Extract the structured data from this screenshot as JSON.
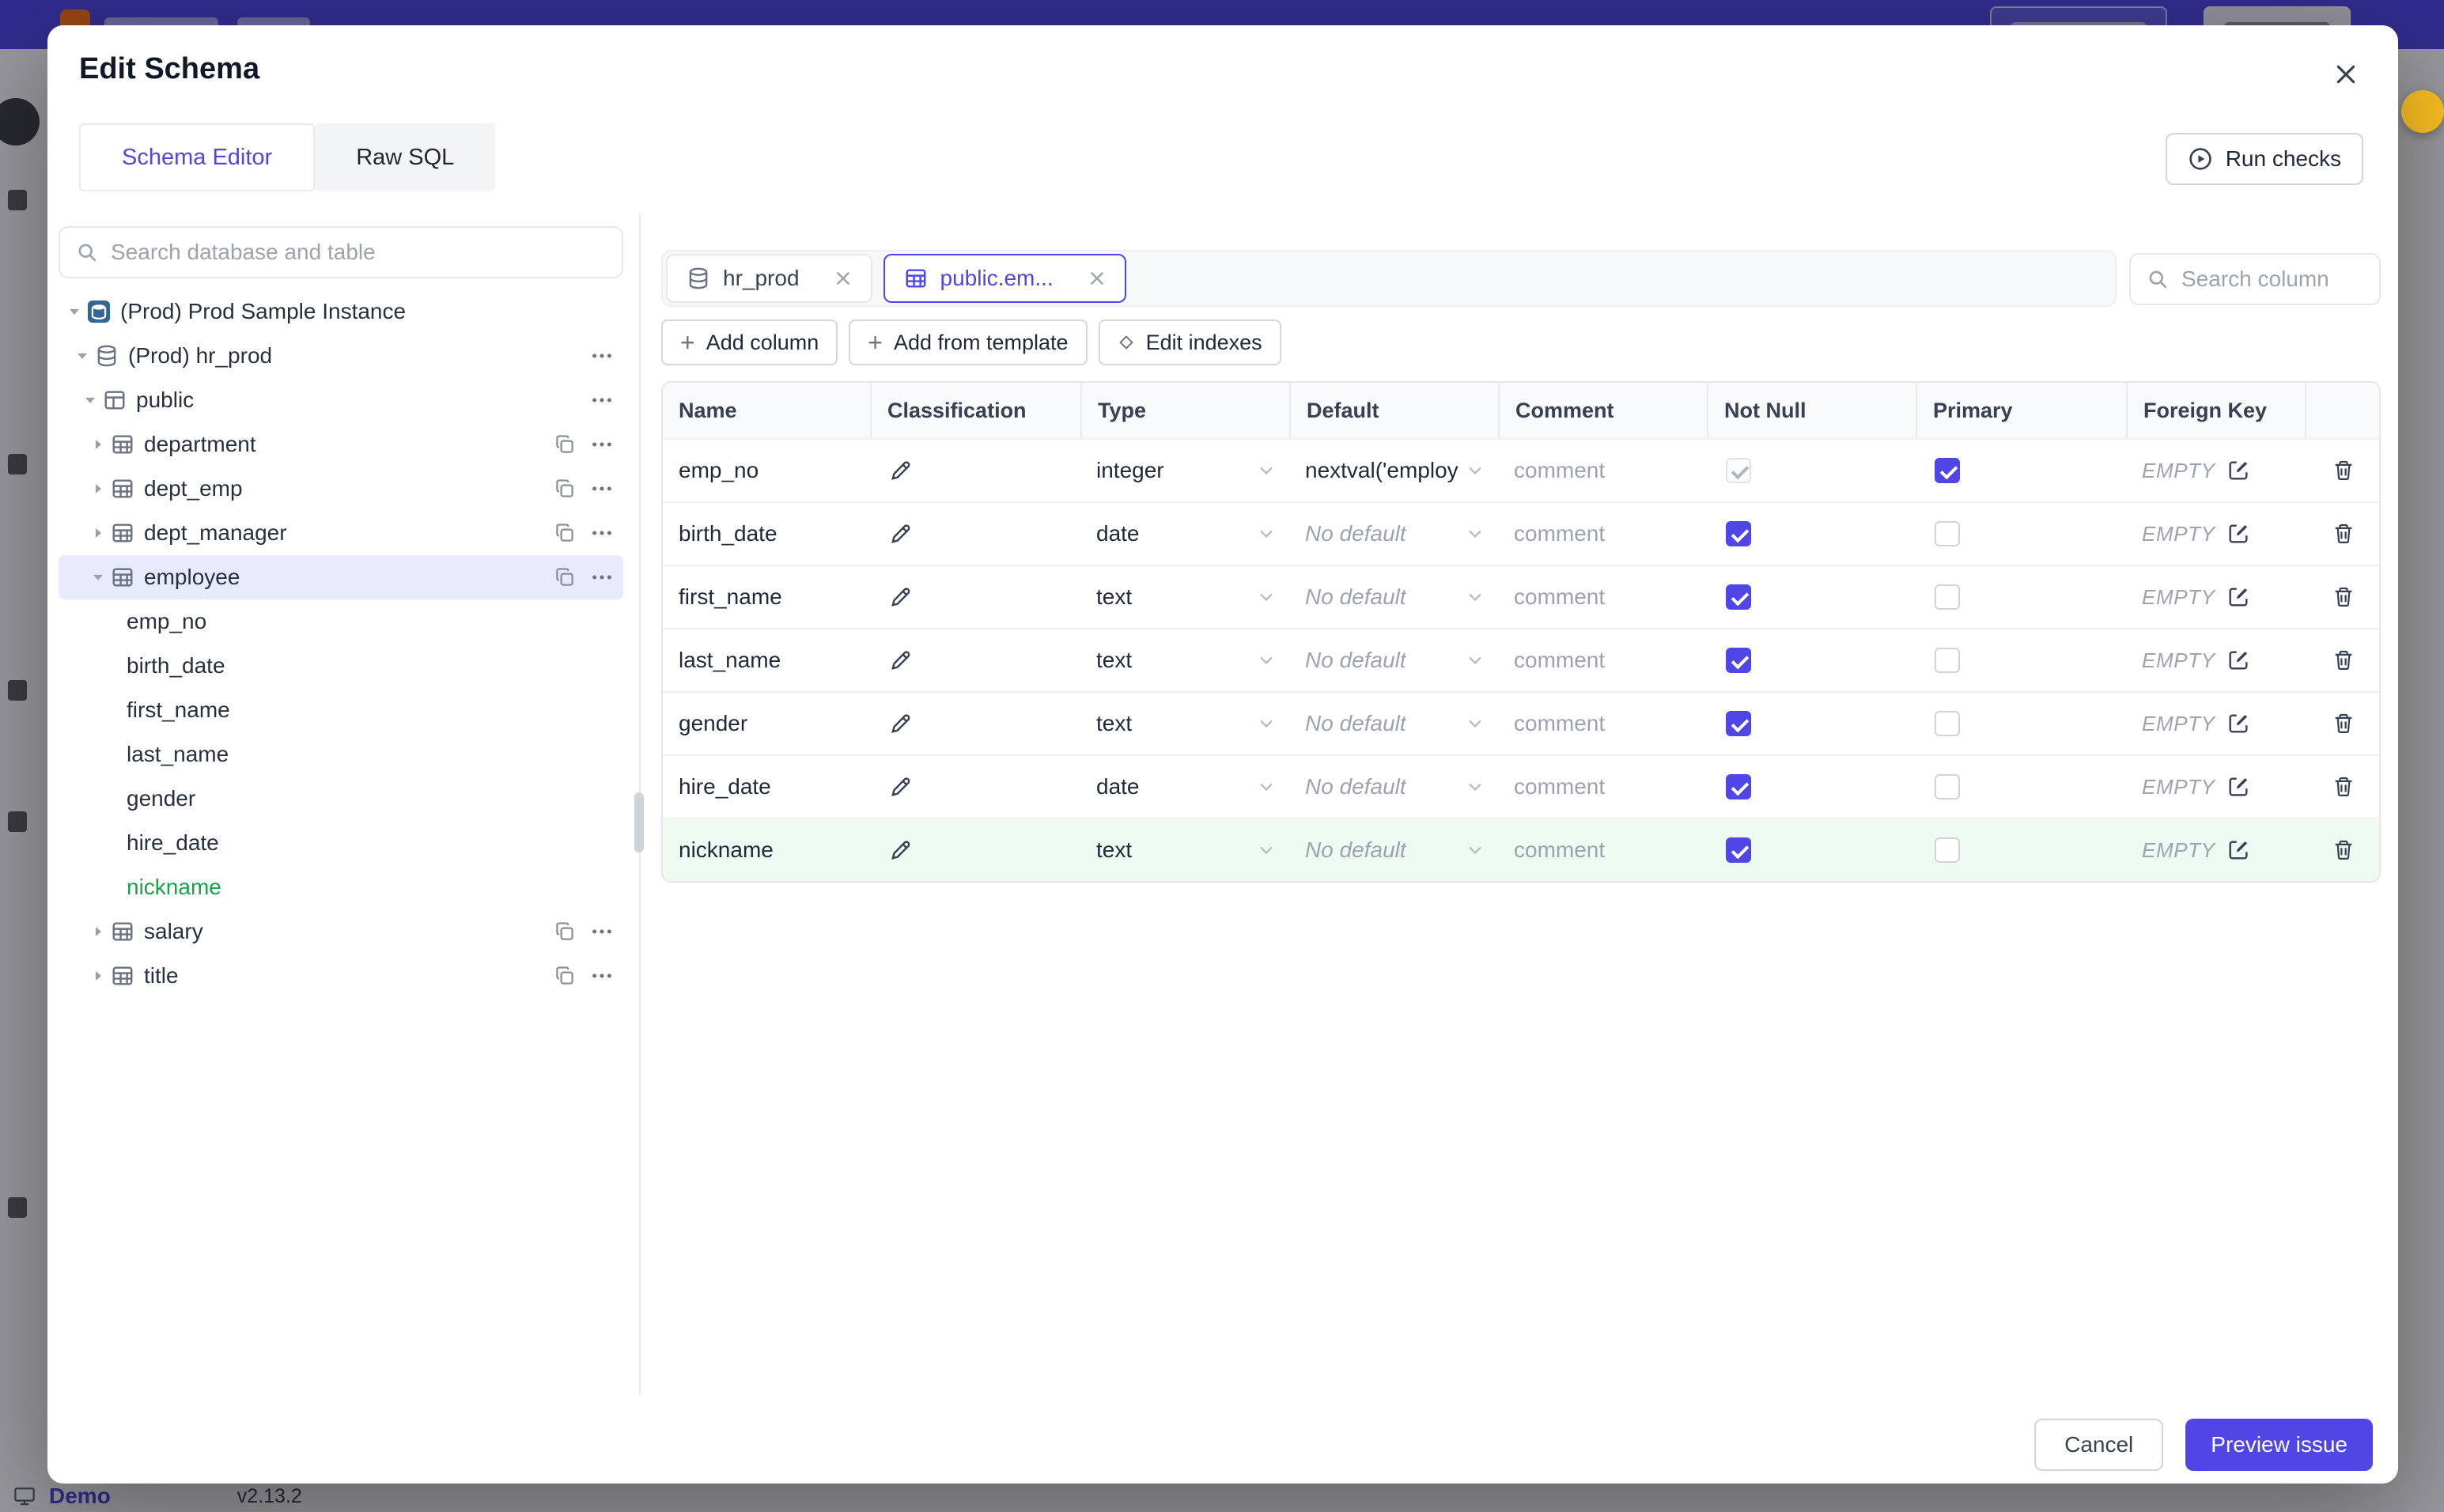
{
  "background": {
    "demo_label": "Demo",
    "version": "v2.13.2"
  },
  "modal": {
    "title": "Edit Schema",
    "tabs": [
      {
        "label": "Schema Editor",
        "active": true
      },
      {
        "label": "Raw SQL",
        "active": false
      }
    ],
    "run_checks": "Run checks",
    "left_panel": {
      "search_placeholder": "Search database and table",
      "tree": [
        {
          "label": "(Prod) Prod Sample Instance",
          "level": 1,
          "icon": "instance",
          "caret": "down"
        },
        {
          "label": "(Prod) hr_prod",
          "level": 2,
          "icon": "database",
          "caret": "down",
          "kebab": true
        },
        {
          "label": "public",
          "level": 3,
          "icon": "schema",
          "caret": "down",
          "kebab": true
        },
        {
          "label": "department",
          "level": 4,
          "icon": "table",
          "caret": "right",
          "copy": true,
          "kebab": true
        },
        {
          "label": "dept_emp",
          "level": 4,
          "icon": "table",
          "caret": "right",
          "copy": true,
          "kebab": true
        },
        {
          "label": "dept_manager",
          "level": 4,
          "icon": "table",
          "caret": "right",
          "copy": true,
          "kebab": true
        },
        {
          "label": "employee",
          "level": 4,
          "icon": "table",
          "caret": "down",
          "copy": true,
          "kebab": true,
          "selected": true
        },
        {
          "label": "emp_no",
          "level": 5
        },
        {
          "label": "birth_date",
          "level": 5
        },
        {
          "label": "first_name",
          "level": 5
        },
        {
          "label": "last_name",
          "level": 5
        },
        {
          "label": "gender",
          "level": 5
        },
        {
          "label": "hire_date",
          "level": 5
        },
        {
          "label": "nickname",
          "level": 5,
          "is_new": true
        },
        {
          "label": "salary",
          "level": 4,
          "icon": "table",
          "caret": "right",
          "copy": true,
          "kebab": true
        },
        {
          "label": "title",
          "level": 4,
          "icon": "table",
          "caret": "right",
          "copy": true,
          "kebab": true
        }
      ]
    },
    "right_panel": {
      "chips": [
        {
          "label": "hr_prod",
          "icon": "database",
          "active": false
        },
        {
          "label": "public.em...",
          "icon": "table",
          "active": true
        }
      ],
      "column_search_placeholder": "Search column",
      "toolbar": [
        {
          "label": "Add column",
          "icon": "plus"
        },
        {
          "label": "Add from template",
          "icon": "plus"
        },
        {
          "label": "Edit indexes",
          "icon": "diamond"
        }
      ],
      "table": {
        "headers": [
          "Name",
          "Classification",
          "Type",
          "Default",
          "Comment",
          "Not Null",
          "Primary",
          "Foreign Key",
          ""
        ],
        "comment_placeholder": "comment",
        "foreign_key_empty": "EMPTY",
        "rows": [
          {
            "name": "emp_no",
            "type": "integer",
            "default": "nextval('employ",
            "default_placeholder": false,
            "comment": "comment",
            "not_null": "disabled-checked",
            "primary": "checked",
            "foreign_key": "EMPTY",
            "is_new": false
          },
          {
            "name": "birth_date",
            "type": "date",
            "default": "No default",
            "default_placeholder": true,
            "comment": "comment",
            "not_null": "checked",
            "primary": "unchecked",
            "foreign_key": "EMPTY",
            "is_new": false
          },
          {
            "name": "first_name",
            "type": "text",
            "default": "No default",
            "default_placeholder": true,
            "comment": "comment",
            "not_null": "checked",
            "primary": "unchecked",
            "foreign_key": "EMPTY",
            "is_new": false
          },
          {
            "name": "last_name",
            "type": "text",
            "default": "No default",
            "default_placeholder": true,
            "comment": "comment",
            "not_null": "checked",
            "primary": "unchecked",
            "foreign_key": "EMPTY",
            "is_new": false
          },
          {
            "name": "gender",
            "type": "text",
            "default": "No default",
            "default_placeholder": true,
            "comment": "comment",
            "not_null": "checked",
            "primary": "unchecked",
            "foreign_key": "EMPTY",
            "is_new": false
          },
          {
            "name": "hire_date",
            "type": "date",
            "default": "No default",
            "default_placeholder": true,
            "comment": "comment",
            "not_null": "checked",
            "primary": "unchecked",
            "foreign_key": "EMPTY",
            "is_new": false
          },
          {
            "name": "nickname",
            "type": "text",
            "default": "No default",
            "default_placeholder": true,
            "comment": "comment",
            "not_null": "checked",
            "primary": "unchecked",
            "foreign_key": "EMPTY",
            "is_new": true
          }
        ]
      }
    },
    "footer": {
      "cancel": "Cancel",
      "submit": "Preview issue"
    }
  },
  "colors": {
    "accent": "#4f46e5",
    "new_column_green": "#16a34a",
    "new_row_bg": "#effaf3",
    "selected_row_bg": "#e8ebfd"
  }
}
